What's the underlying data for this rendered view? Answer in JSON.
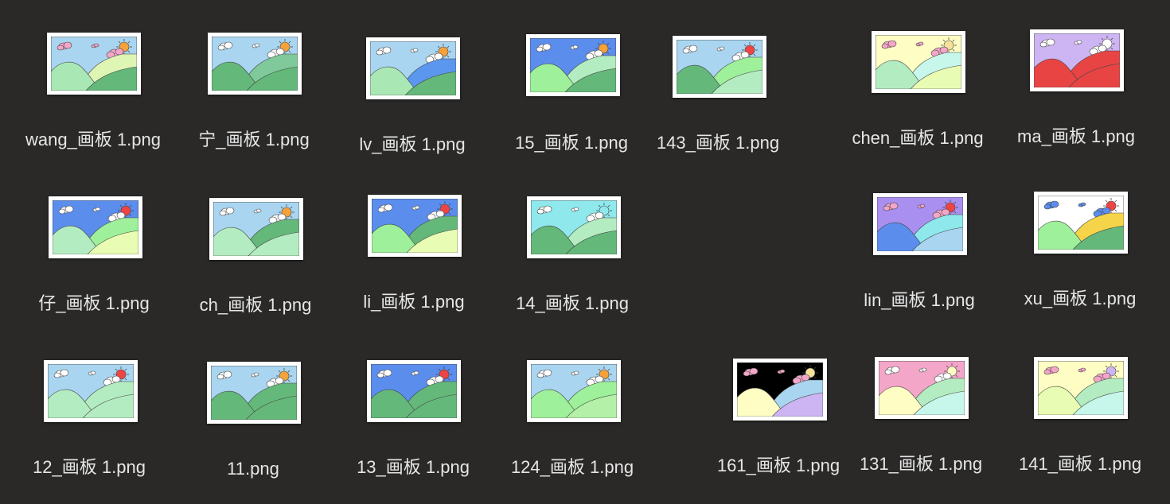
{
  "files": [
    {
      "name": "wang_画板 1.png",
      "sky": "#a9d5f0",
      "hill_back": "#dff5b3",
      "hill_mid": "#ffffff",
      "hill_front": "#64b87a",
      "hill_left": "#a9e8b5",
      "sun": "#f6a23a",
      "cloud": "#f4a6c9"
    },
    {
      "name": "宁_画板 1.png",
      "sky": "#a9d5f0",
      "hill_back": "#7fc99a",
      "hill_mid": "#ffffff",
      "hill_front": "#64b87a",
      "hill_left": "#64b87a",
      "sun": "#f6a23a",
      "cloud": "#ffffff"
    },
    {
      "name": "lv_画板 1.png",
      "sky": "#a9d5f0",
      "hill_back": "#5b97ee",
      "hill_mid": "#ffffff",
      "hill_front": "#64b87a",
      "hill_left": "#a9e8b5",
      "sun": "#f6a23a",
      "cloud": "#ffffff"
    },
    {
      "name": "15_画板 1.png",
      "sky": "#5b8ded",
      "hill_back": "#b4ecc1",
      "hill_mid": "#ffffff",
      "hill_front": "#64b87a",
      "hill_left": "#9ef09a",
      "sun": "#f6a23a",
      "cloud": "#ffffff"
    },
    {
      "name": "143_画板 1.png",
      "sky": "#a9d5f0",
      "hill_back": "#9ef09a",
      "hill_mid": "#ffffff",
      "hill_front": "#b4ecc1",
      "hill_left": "#64b87a",
      "sun": "#ee4444",
      "cloud": "#ffffff"
    },
    {
      "name": "chen_画板 1.png",
      "sky": "#fdfdc4",
      "hill_back": "#c7f7ea",
      "hill_mid": "#ffffff",
      "hill_front": "#e8fdb3",
      "hill_left": "#b4ecc1",
      "sun": "#f6e19a",
      "cloud": "#f4a6c9"
    },
    {
      "name": "ma_画板 1.png",
      "sky": "#cdb4f2",
      "hill_back": "#e84444",
      "hill_mid": "#ffffff",
      "hill_front": "#e84444",
      "hill_left": "#e84444",
      "sun": "#ffffff",
      "cloud": "#ffffff"
    },
    {
      "name": "仔_画板 1.png",
      "sky": "#5b8ded",
      "hill_back": "#9ef09a",
      "hill_mid": "#ffffff",
      "hill_front": "#e8fdb3",
      "hill_left": "#b4ecc1",
      "sun": "#ee4444",
      "cloud": "#ffffff"
    },
    {
      "name": "ch_画板 1.png",
      "sky": "#a9d5f0",
      "hill_back": "#64b87a",
      "hill_mid": "#ffffff",
      "hill_front": "#b4ecc1",
      "hill_left": "#b4ecc1",
      "sun": "#f6a23a",
      "cloud": "#ffffff"
    },
    {
      "name": "li_画板 1.png",
      "sky": "#5b8ded",
      "hill_back": "#64b87a",
      "hill_mid": "#ffffff",
      "hill_front": "#e8fdb3",
      "hill_left": "#9ef09a",
      "sun": "#ee4444",
      "cloud": "#ffffff"
    },
    {
      "name": "14_画板 1.png",
      "sky": "#8ee8ec",
      "hill_back": "#b4ecc1",
      "hill_mid": "#ffffff",
      "hill_front": "#64b87a",
      "hill_left": "#64b87a",
      "sun": "#8ee8ec",
      "cloud": "#ffffff"
    },
    {
      "name": "lin_画板 1.png",
      "sky": "#a88ff0",
      "hill_back": "#8ee8ec",
      "hill_mid": "#ffffff",
      "hill_front": "#a9d5f0",
      "hill_left": "#5b8ded",
      "sun": "#ee4444",
      "cloud": "#f4a6c9"
    },
    {
      "name": "xu_画板 1.png",
      "sky": "#ffffff",
      "hill_back": "#f6d44a",
      "hill_mid": "#ffffff",
      "hill_front": "#64b87a",
      "hill_left": "#9ef09a",
      "sun": "#ee4444",
      "cloud": "#5b8ded"
    },
    {
      "name": "12_画板 1.png",
      "sky": "#a9d5f0",
      "hill_back": "#b4ecc1",
      "hill_mid": "#ffffff",
      "hill_front": "#b4ecc1",
      "hill_left": "#b4ecc1",
      "sun": "#ee4444",
      "cloud": "#ffffff"
    },
    {
      "name": "11.png",
      "sky": "#a9d5f0",
      "hill_back": "#64b87a",
      "hill_mid": "#ffffff",
      "hill_front": "#64b87a",
      "hill_left": "#64b87a",
      "sun": "#f6a23a",
      "cloud": "#ffffff"
    },
    {
      "name": "13_画板 1.png",
      "sky": "#5b8ded",
      "hill_back": "#64b87a",
      "hill_mid": "#ffffff",
      "hill_front": "#64b87a",
      "hill_left": "#64b87a",
      "sun": "#ee4444",
      "cloud": "#ffffff"
    },
    {
      "name": "124_画板 1.png",
      "sky": "#a9d5f0",
      "hill_back": "#9ef09a",
      "hill_mid": "#ffffff",
      "hill_front": "#b4f0a8",
      "hill_left": "#9ef09a",
      "sun": "#f6a23a",
      "cloud": "#ffffff"
    },
    {
      "name": "161_画板 1.png",
      "sky": "#000000",
      "hill_back": "#a9d5f0",
      "hill_mid": "#ffffff",
      "hill_front": "#cdb4f2",
      "hill_left": "#fdfdc4",
      "sun": "#f6e19a",
      "cloud": "#f4a6c9"
    },
    {
      "name": "131_画板 1.png",
      "sky": "#f4a6c9",
      "hill_back": "#b4ecc1",
      "hill_mid": "#ffffff",
      "hill_front": "#c7f7ea",
      "hill_left": "#fdfdc4",
      "sun": "#fdfdc4",
      "cloud": "#ffffff"
    },
    {
      "name": "141_画板 1.png",
      "sky": "#fdfdc4",
      "hill_back": "#b4ecc1",
      "hill_mid": "#ffffff",
      "hill_front": "#c7f7ea",
      "hill_left": "#e8fdb3",
      "sun": "#cdb4f2",
      "cloud": "#f4a6c9"
    }
  ]
}
